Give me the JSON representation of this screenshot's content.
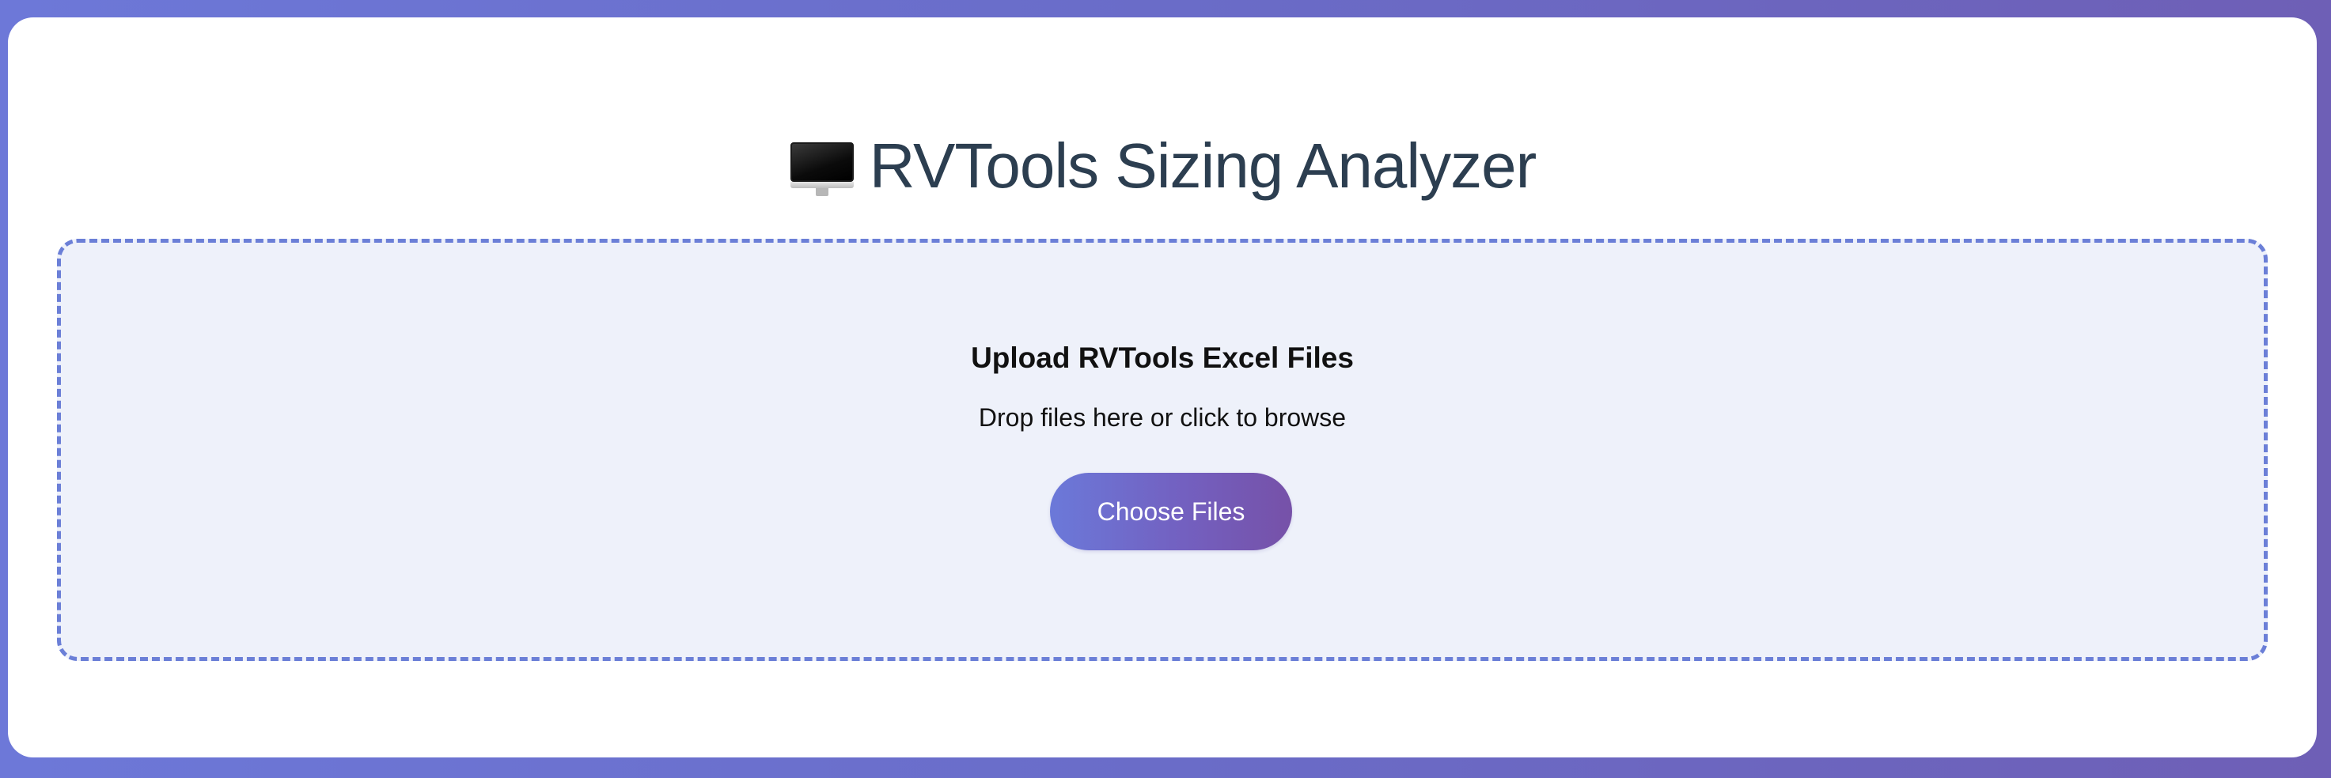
{
  "header": {
    "icon": "desktop-computer-icon",
    "title": "RVTools Sizing Analyzer"
  },
  "upload": {
    "heading": "Upload RVTools Excel Files",
    "instruction": "Drop files here or click to browse",
    "button_label": "Choose Files"
  },
  "colors": {
    "background_gradient_start": "#6d78d8",
    "background_gradient_end": "#6e5fb6",
    "dropzone_border": "#6b7fd7",
    "dropzone_fill": "#eef1fa",
    "title_text": "#2c3e50",
    "button_gradient_start": "#6b79d9",
    "button_gradient_end": "#7651a8"
  }
}
